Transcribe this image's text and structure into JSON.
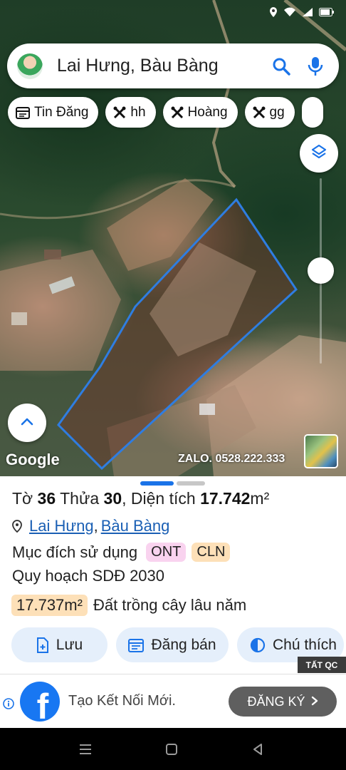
{
  "search": {
    "query": "Lai Hưng, Bàu Bàng"
  },
  "chips": [
    {
      "label": "Tin Đăng",
      "icon": "calendar-icon"
    },
    {
      "label": "hh",
      "icon": "tools-icon"
    },
    {
      "label": "Hoàng",
      "icon": "tools-icon"
    },
    {
      "label": "gg",
      "icon": "tools-icon"
    }
  ],
  "map": {
    "google_logo": "Google",
    "watermark": "ZALO. 0528.222.333",
    "parcel_outline_color": "#2f7de1"
  },
  "parcel": {
    "to_label": "Tờ",
    "to_value": "36",
    "thua_label": "Thửa",
    "thua_value": "30",
    "area_label": "Diện tích",
    "area_value": "17.742",
    "area_unit": "m²",
    "commune": "Lai Hưng",
    "district": "Bàu Bàng",
    "purpose_label": "Mục đích sử dụng",
    "purpose_tags": [
      "ONT",
      "CLN"
    ],
    "plan_label": "Quy hoạch SDĐ 2030",
    "plan_area": "17.737m²",
    "plan_use": "Đất trồng cây lâu năm"
  },
  "actions": {
    "save": "Lưu",
    "sell": "Đăng bán",
    "legend": "Chú thích"
  },
  "ad": {
    "badge": "TẤT QC",
    "text": "Tạo Kết Nối Mới.",
    "cta": "ĐĂNG KÝ",
    "brand_color": "#1877f2"
  },
  "colors": {
    "accent": "#1a73e8",
    "link": "#1a5fb4",
    "tag_pink": "#f9d3ef",
    "tag_orange": "#fde0b8",
    "button_bg": "#e5effb"
  }
}
